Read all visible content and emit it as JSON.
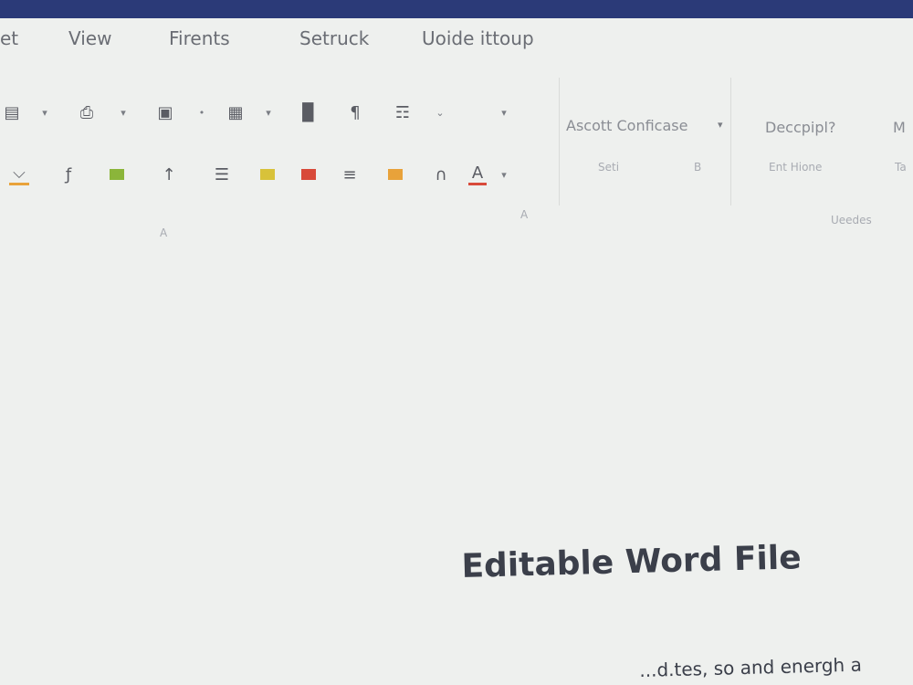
{
  "menu": {
    "items": [
      "et",
      "View",
      "Firents",
      "Setruck",
      "Uoide ittoup"
    ]
  },
  "toolbar": {
    "row1_icons": [
      "align-icon",
      "chevron-down-icon",
      "paste-icon",
      "chevron-down-icon",
      "table-icon",
      "chevron-down-icon",
      "grid-icon",
      "chevron-down-icon",
      "chart-icon",
      "paragraph-icon",
      "format-icon",
      "chevron-down-icon",
      "chevron-down-icon"
    ],
    "row2_icons": [
      "underline-color-icon",
      "function-icon",
      "highlight-green-icon",
      "superscript-icon",
      "list-icon",
      "bullets-yellow-icon",
      "bullets-red-icon",
      "indent-icon",
      "border-orange-icon",
      "arch-icon",
      "font-color-icon",
      "chevron-down-icon"
    ]
  },
  "ribbon": {
    "font_dropdown": "Ascott Conficase",
    "style_dropdown": "Deccpipl?",
    "edge_label": "M",
    "faint_1": "Seti",
    "faint_2": "B",
    "faint_3": "Ent Hione",
    "faint_4": "Ta",
    "faint_5": "Ueedes",
    "faint_6": "A",
    "faint_7": "A"
  },
  "colors": {
    "titlebar": "#2b3a78",
    "accent_orange": "#e8a23a",
    "accent_green": "#8bb53a",
    "accent_red": "#d84a3a"
  },
  "document": {
    "heading": "Editable Word File",
    "body_fragment": "...d.tes, so and energh a"
  }
}
